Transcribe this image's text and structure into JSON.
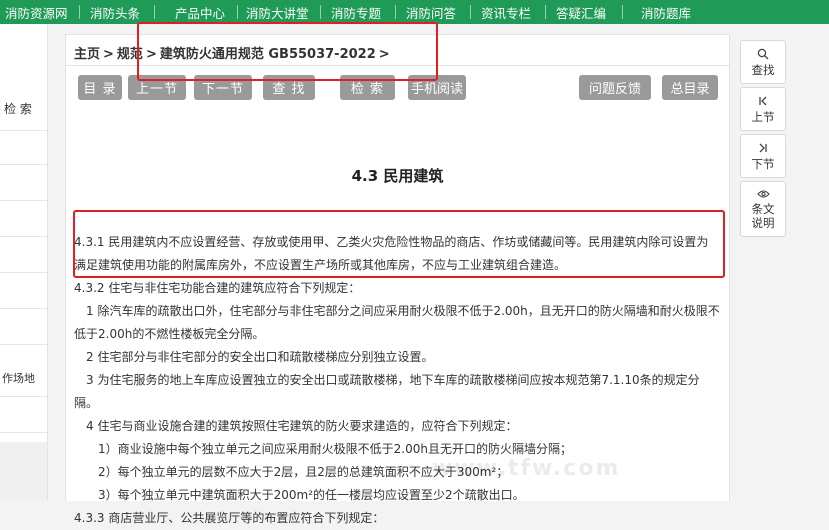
{
  "topnav": {
    "items": [
      "消防资源网",
      "消防头条",
      "产品中心",
      "消防大讲堂",
      "消防专题",
      "消防问答",
      "资讯专栏",
      "答疑汇编",
      "消防题库"
    ]
  },
  "leftbar": {
    "search_label": "检 索",
    "fragment": "作场地"
  },
  "breadcrumb": {
    "home": "主页",
    "sep": ">",
    "level2": "规范",
    "current": "建筑防火通用规范 GB55037-2022",
    "trail": ">"
  },
  "toolbar": {
    "catalog": "目 录",
    "prev": "上一节",
    "next": "下一节",
    "find": "查 找",
    "search": "检 索",
    "mobile": "手机阅读",
    "feedback": "问题反馈",
    "toc": "总目录"
  },
  "section_title": "4.3 民用建筑",
  "paragraphs": [
    "4.3.1 民用建筑内不应设置经营、存放或使用甲、乙类火灾危险性物品的商店、作坊或储藏间等。民用建筑内除可设置为满足建筑使用功能的附属库房外，不应设置生产场所或其他库房，不应与工业建筑组合建造。",
    "4.3.2 住宅与非住宅功能合建的建筑应符合下列规定：",
    "1 除汽车库的疏散出口外，住宅部分与非住宅部分之间应采用耐火极限不低于2.00h，且无开口的防火隔墙和耐火极限不低于2.00h的不燃性楼板完全分隔。",
    "2 住宅部分与非住宅部分的安全出口和疏散楼梯应分别独立设置。",
    "3 为住宅服务的地上车库应设置独立的安全出口或疏散楼梯，地下车库的疏散楼梯间应按本规范第7.1.10条的规定分隔。",
    "4 住宅与商业设施合建的建筑按照住宅建筑的防火要求建造的，应符合下列规定：",
    "1）商业设施中每个独立单元之间应采用耐火极限不低于2.00h且无开口的防火隔墙分隔；",
    "2）每个独立单元的层数不应大于2层，且2层的总建筑面积不应大于300m²；",
    "3）每个独立单元中建筑面积大于200m²的任一楼层均应设置至少2个疏散出口。",
    "4.3.3 商店营业厅、公共展览厅等的布置应符合下列规定："
  ],
  "rightbar": {
    "find": "查找",
    "prev": "上节",
    "next": "下节",
    "notes_line1": "条文",
    "notes_line2": "说明"
  },
  "watermark": "www.tfw.com",
  "colors": {
    "nav_green": "#1f9a57",
    "highlight_red": "#e02020",
    "button_gray": "#9a9a9a"
  }
}
